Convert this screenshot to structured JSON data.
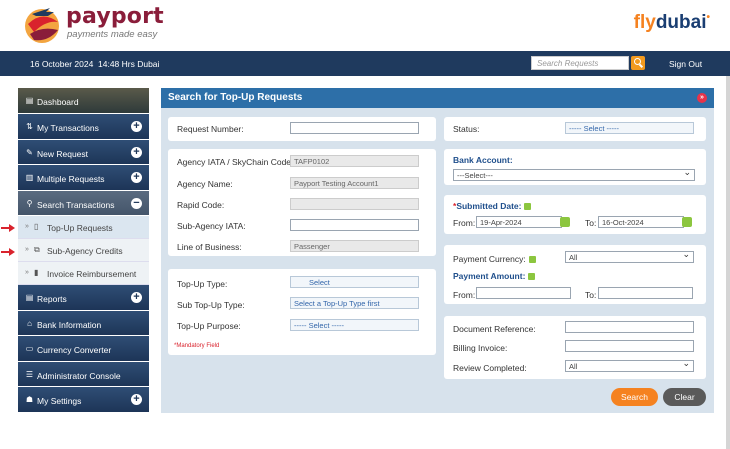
{
  "brand": {
    "name": "payport",
    "tagline": "payments made easy",
    "partner_fly": "fly",
    "partner_dubai": "dubai",
    "partner_dot": "•"
  },
  "topbar": {
    "date": "16 October 2024",
    "time": "14:48 Hrs Dubai",
    "search_placeholder": "Search Requests",
    "signout": "Sign Out"
  },
  "sidebar": {
    "dashboard": "Dashboard",
    "my_transactions": "My Transactions",
    "new_request": "New Request",
    "multiple_requests": "Multiple Requests",
    "search_transactions": "Search Transactions",
    "sub": {
      "topup": "Top-Up Requests",
      "subagency": "Sub-Agency Credits",
      "invoice": "Invoice Reimbursement"
    },
    "reports": "Reports",
    "bank_info": "Bank Information",
    "currency": "Currency Converter",
    "admin": "Administrator Console",
    "settings": "My Settings",
    "plus": "+",
    "minus": "−",
    "arrow": "»"
  },
  "panel": {
    "title": "Search for Top-Up Requests",
    "collapse_icon": "»",
    "request_number_label": "Request Number:",
    "request_number_value": "",
    "agency_iata_label": "Agency IATA / SkyChain Code:",
    "agency_iata_value": "TAFP0102",
    "agency_name_label": "Agency Name:",
    "agency_name_value": "Payport Testing Account1",
    "rapid_code_label": "Rapid Code:",
    "rapid_code_value": "",
    "subagency_iata_label": "Sub-Agency IATA:",
    "subagency_iata_value": "",
    "lob_label": "Line of Business:",
    "lob_value": "Passenger",
    "topup_type_label": "Top-Up Type:",
    "topup_type_value": "Select",
    "sub_topup_type_label": "Sub Top-Up Type:",
    "sub_topup_type_value": "Select a Top-Up Type first",
    "topup_purpose_label": "Top-Up Purpose:",
    "topup_purpose_value": "----- Select -----",
    "mandatory": "*Mandatory Field",
    "status_label": "Status:",
    "status_value": "----- Select -----",
    "bank_account_label": "Bank Account:",
    "bank_account_value": "---Select---",
    "submitted_date_label": "Submitted Date:",
    "from_label": "From:",
    "from_value": "19-Apr-2024",
    "to_label": "To:",
    "to_value": "16-Oct-2024",
    "payment_currency_label": "Payment Currency:",
    "payment_currency_value": "All",
    "payment_amount_label": "Payment Amount:",
    "amt_from_label": "From:",
    "amt_to_label": "To:",
    "doc_ref_label": "Document Reference:",
    "billing_invoice_label": "Billing Invoice:",
    "review_completed_label": "Review Completed:",
    "review_completed_value": "All",
    "search_button": "Search",
    "clear_button": "Clear"
  },
  "colors": {
    "navy": "#1f3a5e",
    "accent_orange": "#f58220",
    "panel_blue": "#2d6fa8",
    "brand_maroon": "#8a1d3a"
  }
}
